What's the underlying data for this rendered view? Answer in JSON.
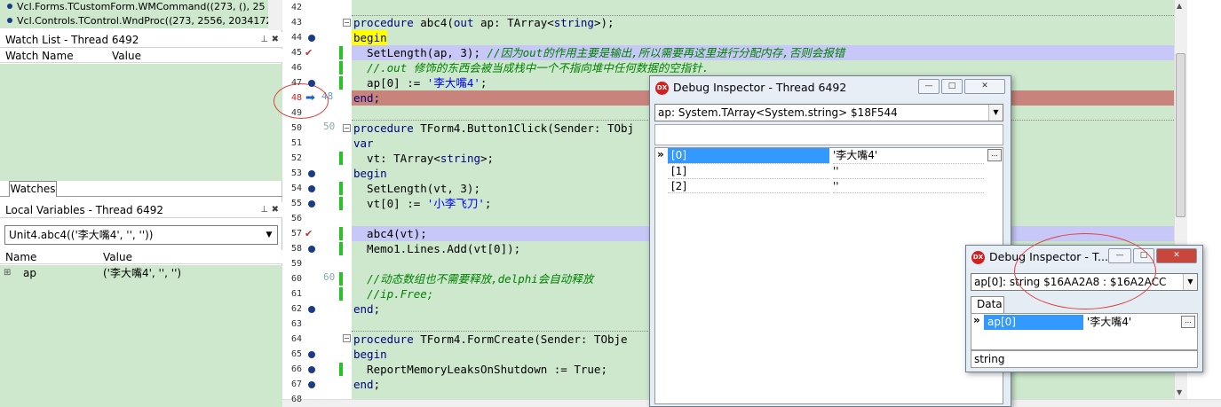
{
  "call_stack": {
    "items": [
      "Vcl.Forms.TCustomForm.WMCommand((273, (), 25",
      "Vcl.Controls.TControl.WndProc((273, 2556, 2034172,"
    ]
  },
  "watch_list": {
    "title": "Watch List - Thread 6492",
    "columns": [
      "Watch Name",
      "Value"
    ],
    "tab_label": "Watches"
  },
  "local_variables": {
    "title": "Local Variables - Thread 6492",
    "selected_frame": "Unit4.abc4(('李大嘴4', '', ''))",
    "columns": [
      "Name",
      "Value"
    ],
    "rows": [
      {
        "name": "ap",
        "value": "('李大嘴4', '', '')"
      }
    ]
  },
  "editor": {
    "lines": [
      {
        "num": "42",
        "text": ""
      },
      {
        "num": "43",
        "text": "procedure abc4(out ap: TArray<string>);"
      },
      {
        "num": "44",
        "text": "begin"
      },
      {
        "num": "45",
        "text": "  SetLength(ap, 3); //因为out的作用主要是输出,所以需要再这里进行分配内存,否则会报错"
      },
      {
        "num": "46",
        "text": "  //.out 修饰的东西会被当成栈中一个不指向堆中任何数据的空指针."
      },
      {
        "num": "47",
        "text": "  ap[0] := '李大嘴4';"
      },
      {
        "num": "48",
        "text": "end;"
      },
      {
        "num": "49",
        "text": ""
      },
      {
        "num": "50",
        "text": "procedure TForm4.Button1Click(Sender: TObj"
      },
      {
        "num": "51",
        "text": "var"
      },
      {
        "num": "52",
        "text": "  vt: TArray<string>;"
      },
      {
        "num": "53",
        "text": "begin"
      },
      {
        "num": "54",
        "text": "  SetLength(vt, 3);"
      },
      {
        "num": "55",
        "text": "  vt[0] := '小李飞刀';"
      },
      {
        "num": "56",
        "text": ""
      },
      {
        "num": "57",
        "text": "  abc4(vt);"
      },
      {
        "num": "58",
        "text": "  Memo1.Lines.Add(vt[0]);"
      },
      {
        "num": "59",
        "text": ""
      },
      {
        "num": "60",
        "text": "  //动态数组也不需要释放,delphi会自动释放"
      },
      {
        "num": "61",
        "text": "  //ip.Free;"
      },
      {
        "num": "62",
        "text": "end;"
      },
      {
        "num": "63",
        "text": ""
      },
      {
        "num": "64",
        "text": "procedure TForm4.FormCreate(Sender: TObje"
      },
      {
        "num": "65",
        "text": "begin"
      },
      {
        "num": "66",
        "text": "  ReportMemoryLeaksOnShutdown := True;"
      },
      {
        "num": "67",
        "text": "end;"
      },
      {
        "num": "68",
        "text": ""
      }
    ],
    "gutter_hints": {
      "line48": "48",
      "line50": "50",
      "line60": "60"
    }
  },
  "inspector1": {
    "title": "Debug Inspector - Thread 6492",
    "expression": "ap: System.TArray<System.string> $18F544",
    "rows": [
      {
        "index": "[0]",
        "value": "'李大嘴4'"
      },
      {
        "index": "[1]",
        "value": "''"
      },
      {
        "index": "[2]",
        "value": "''"
      }
    ],
    "min": "—",
    "max": "□",
    "close": "✕",
    "ellipsis": "..."
  },
  "inspector2": {
    "title": "Debug Inspector - T...",
    "expression": "ap[0]: string $16AA2A8 : $16A2ACC",
    "tab": "Data",
    "rows": [
      {
        "name": "ap[0]",
        "value": "'李大嘴4'"
      }
    ],
    "status": "string",
    "min": "—",
    "max": "□",
    "close": "✕",
    "ellipsis": "..."
  },
  "icons": {
    "pin": "📌",
    "close": "✖",
    "dx": "DX",
    "exec_arrow": "➡",
    "fold_minus": "−",
    "combo_arrow": "▼",
    "grid_indicator": "»",
    "expand_plus": "⊞"
  },
  "colors": {
    "editor_bg": "#cde8cd",
    "current_line": "#c8847c",
    "breakpoint_line": "#c8c8f8",
    "breakpoint_dot": "#1b3b8a",
    "selection": "#3399ff"
  }
}
